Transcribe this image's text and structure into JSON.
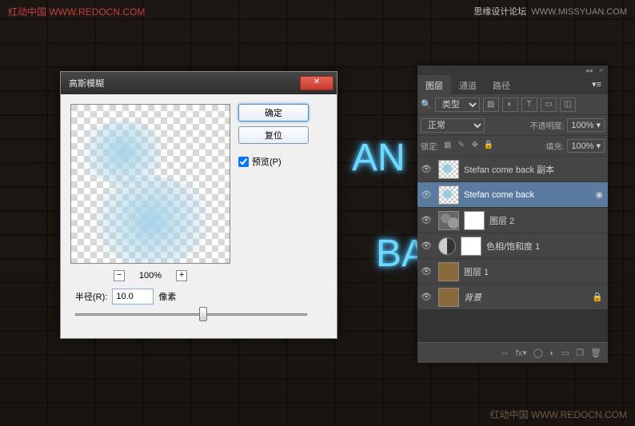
{
  "watermarks": {
    "top_left": "红动中国 WWW.REDOCN.COM",
    "top_right_text": "思缘设计论坛",
    "top_right_url": "WWW.MISSYUAN.COM",
    "bottom_right": "红动中国 WWW.REDOCN.COM"
  },
  "neon": {
    "line1": "AN",
    "line2": "BA"
  },
  "dialog": {
    "title": "高斯模糊",
    "ok": "确定",
    "reset": "复位",
    "preview_label": "预览(P)",
    "preview_checked": true,
    "zoom_out": "−",
    "zoom_pct": "100%",
    "zoom_in": "+",
    "radius_label": "半径(R):",
    "radius_value": "10.0",
    "radius_unit": "像素",
    "close_x": "✕"
  },
  "panel": {
    "tabs": {
      "layers": "图层",
      "channels": "通道",
      "paths": "路径"
    },
    "type_filter": "类型",
    "blend_mode": "正常",
    "opacity_label": "不透明度:",
    "opacity_value": "100%",
    "lock_label": "锁定:",
    "fill_label": "填充:",
    "fill_value": "100%",
    "layers": [
      {
        "name": "Stefan  come back 副本"
      },
      {
        "name": "Stefan  come back"
      },
      {
        "name": "图层 2"
      },
      {
        "name": "色相/饱和度 1"
      },
      {
        "name": "图层 1"
      },
      {
        "name": "背景"
      }
    ]
  }
}
